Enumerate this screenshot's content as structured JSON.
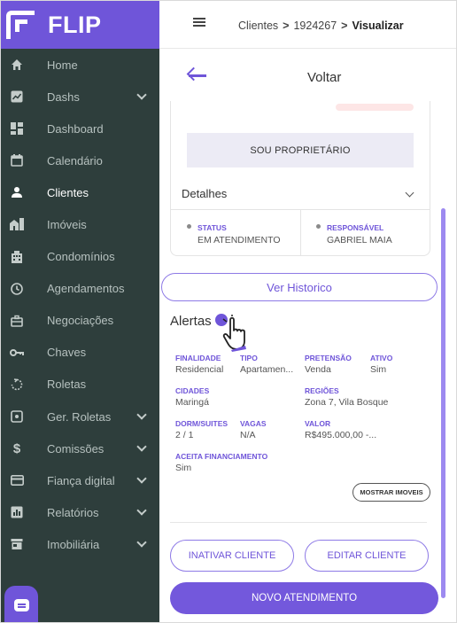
{
  "brand": {
    "name": "FLIP",
    "color": "#6f55d9"
  },
  "sidebar": {
    "items": [
      {
        "label": "Home",
        "icon": "home-icon",
        "chevron": false
      },
      {
        "label": "Dashs",
        "icon": "chart-icon",
        "chevron": true
      },
      {
        "label": "Dashboard",
        "icon": "dashboard-icon",
        "chevron": false
      },
      {
        "label": "Calendário",
        "icon": "calendar-icon",
        "chevron": false
      },
      {
        "label": "Clientes",
        "icon": "person-icon",
        "chevron": false,
        "active": true
      },
      {
        "label": "Imóveis",
        "icon": "building-icon",
        "chevron": false
      },
      {
        "label": "Condomínios",
        "icon": "apartment-icon",
        "chevron": false
      },
      {
        "label": "Agendamentos",
        "icon": "clock-icon",
        "chevron": false
      },
      {
        "label": "Negociações",
        "icon": "briefcase-icon",
        "chevron": false
      },
      {
        "label": "Chaves",
        "icon": "key-icon",
        "chevron": false
      },
      {
        "label": "Roletas",
        "icon": "rotate-icon",
        "chevron": false
      },
      {
        "label": "Ger. Roletas",
        "icon": "dice-icon",
        "chevron": true
      },
      {
        "label": "Comissões",
        "icon": "dollar-icon",
        "chevron": true
      },
      {
        "label": "Fiança digital",
        "icon": "card-icon",
        "chevron": true
      },
      {
        "label": "Relatórios",
        "icon": "report-icon",
        "chevron": true
      },
      {
        "label": "Imobiliária",
        "icon": "store-icon",
        "chevron": true
      }
    ]
  },
  "header": {
    "crumbs": [
      "Clientes",
      "1924267"
    ],
    "current": "Visualizar",
    "separator": ">"
  },
  "page": {
    "back_label": "Voltar"
  },
  "card": {
    "owner_button": "SOU PROPRIETÁRIO",
    "details_label": "Detalhes",
    "status_label": "STATUS",
    "status_value": "EM ATENDIMENTO",
    "responsavel_label": "RESPONSÁVEL",
    "responsavel_value": "GABRIEL MAIA"
  },
  "history_button": "Ver Historico",
  "alerts": {
    "title": "Alertas",
    "fields": {
      "finalidade": {
        "label": "FINALIDADE",
        "value": "Residencial"
      },
      "tipo": {
        "label": "TIPO",
        "value": "Apartamen..."
      },
      "pretensao": {
        "label": "PRETENSÃO",
        "value": "Venda"
      },
      "ativo": {
        "label": "ATIVO",
        "value": "Sim"
      },
      "cidades": {
        "label": "CIDADES",
        "value": "Maringá"
      },
      "regioes": {
        "label": "REGIÕES",
        "value": "Zona 7, Vila Bosque"
      },
      "dorm": {
        "label": "DORM/SUITES",
        "value": "2 / 1"
      },
      "vagas": {
        "label": "VAGAS",
        "value": "N/A"
      },
      "valor": {
        "label": "VALOR",
        "value": "R$495.000,00 -..."
      },
      "financiamento": {
        "label": "ACEITA FINANCIAMENTO",
        "value": "Sim"
      }
    },
    "show_button": "MOSTRAR IMOVEIS"
  },
  "actions": {
    "inactivate": "INATIVAR CLIENTE",
    "edit": "EDITAR CLIENTE",
    "new_service": "NOVO ATENDIMENTO"
  }
}
